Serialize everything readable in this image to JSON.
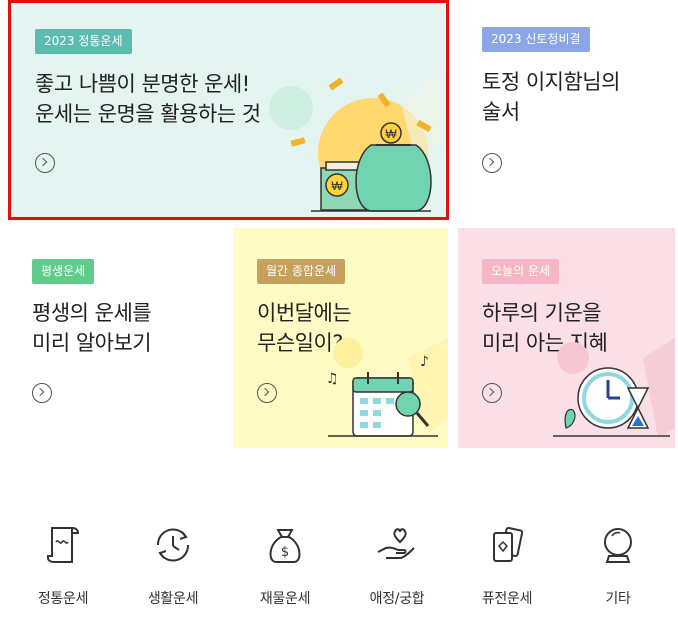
{
  "cards": [
    {
      "tag": "2023 정통운세",
      "title_line1": "좋고 나쁨이 분명한 운세!",
      "title_line2": "운세는 운명을 활용하는 것",
      "selected": true,
      "tag_color": "#5cbcb0",
      "bg_color": "#e4f4f1"
    },
    {
      "tag": "2023 신토정비결",
      "title_line1": "토정 이지함님의",
      "title_line2": "술서",
      "tag_color": "#8aa6e6",
      "bg_color": "#ffffff"
    },
    {
      "tag": "평생운세",
      "title_line1": "평생의 운세를",
      "title_line2": "미리 알아보기",
      "tag_color": "#5fcc8c",
      "bg_color": "#ffffff"
    },
    {
      "tag": "월간 종합운세",
      "title_line1": "이번달에는",
      "title_line2": "무슨일이?",
      "tag_color": "#c6a15e",
      "bg_color": "#fffbc4"
    },
    {
      "tag": "오늘의 운세",
      "title_line1": "하루의 기운을",
      "title_line2": "미리 아는 지혜",
      "tag_color": "#f7b6c3",
      "bg_color": "#fbdfe6"
    }
  ],
  "selection_color": "#e01010",
  "menu": [
    {
      "label": "정통운세",
      "icon": "scroll-icon"
    },
    {
      "label": "생활운세",
      "icon": "clock-cycle-icon"
    },
    {
      "label": "재물운세",
      "icon": "money-bag-icon"
    },
    {
      "label": "애정/궁합",
      "icon": "heart-hand-icon"
    },
    {
      "label": "퓨전운세",
      "icon": "cards-icon"
    },
    {
      "label": "기타",
      "icon": "crystal-ball-icon"
    }
  ]
}
